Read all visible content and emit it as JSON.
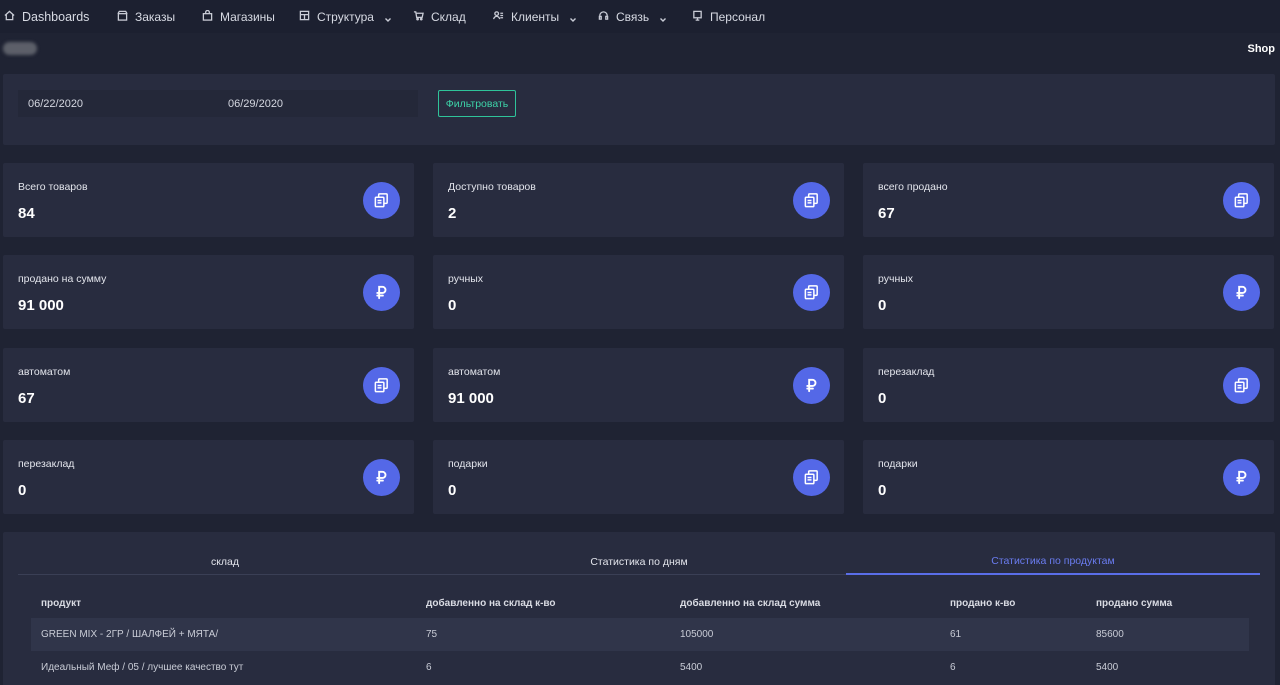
{
  "nav": [
    {
      "label": "Dashboards",
      "icon": "home-icon",
      "dropdown": false
    },
    {
      "label": "Заказы",
      "icon": "store-icon",
      "dropdown": false
    },
    {
      "label": "Магазины",
      "icon": "bag-icon",
      "dropdown": false
    },
    {
      "label": "Структура",
      "icon": "grid-icon",
      "dropdown": true
    },
    {
      "label": "Склад",
      "icon": "cart-icon",
      "dropdown": false
    },
    {
      "label": "Клиенты",
      "icon": "users-icon",
      "dropdown": true
    },
    {
      "label": "Связь",
      "icon": "headset-icon",
      "dropdown": true
    },
    {
      "label": "Персонал",
      "icon": "badge-icon",
      "dropdown": false
    }
  ],
  "header": {
    "shop": "Shop"
  },
  "filter": {
    "date_from": "06/22/2020",
    "date_to": "06/29/2020",
    "button": "Фильтровать"
  },
  "cards": [
    {
      "label": "Всего товаров",
      "value": "84",
      "icon": "copy-icon"
    },
    {
      "label": "Доступно товаров",
      "value": "2",
      "icon": "copy-icon"
    },
    {
      "label": "всего продано",
      "value": "67",
      "icon": "copy-icon"
    },
    {
      "label": "продано на сумму",
      "value": "91 000",
      "icon": "ruble-icon"
    },
    {
      "label": "ручных",
      "value": "0",
      "icon": "copy-icon"
    },
    {
      "label": "ручных",
      "value": "0",
      "icon": "ruble-icon"
    },
    {
      "label": "автоматом",
      "value": "67",
      "icon": "copy-icon"
    },
    {
      "label": "автоматом",
      "value": "91 000",
      "icon": "ruble-icon"
    },
    {
      "label": "перезаклад",
      "value": "0",
      "icon": "copy-icon"
    },
    {
      "label": "перезаклад",
      "value": "0",
      "icon": "ruble-icon"
    },
    {
      "label": "подарки",
      "value": "0",
      "icon": "copy-icon"
    },
    {
      "label": "подарки",
      "value": "0",
      "icon": "ruble-icon"
    }
  ],
  "tabs": [
    {
      "label": "склад",
      "active": false
    },
    {
      "label": "Статистика по дням",
      "active": false
    },
    {
      "label": "Статистика по продуктам",
      "active": true
    }
  ],
  "table": {
    "columns": [
      "продукт",
      "добавленно на склад к-во",
      "добавленно на склад сумма",
      "продано к-во",
      "продано сумма"
    ],
    "rows": [
      [
        "GREEN MIX - 2ГР / ШАЛФЕЙ + МЯТА/",
        "75",
        "105000",
        "61",
        "85600"
      ],
      [
        "Идеальный Меф / 05 / лучшее качество тут",
        "6",
        "5400",
        "6",
        "5400"
      ]
    ]
  },
  "colors": {
    "accent": "#5468e7",
    "filter_button": "#2fc39a",
    "background": "#1f2333",
    "panel": "#282c3f"
  }
}
